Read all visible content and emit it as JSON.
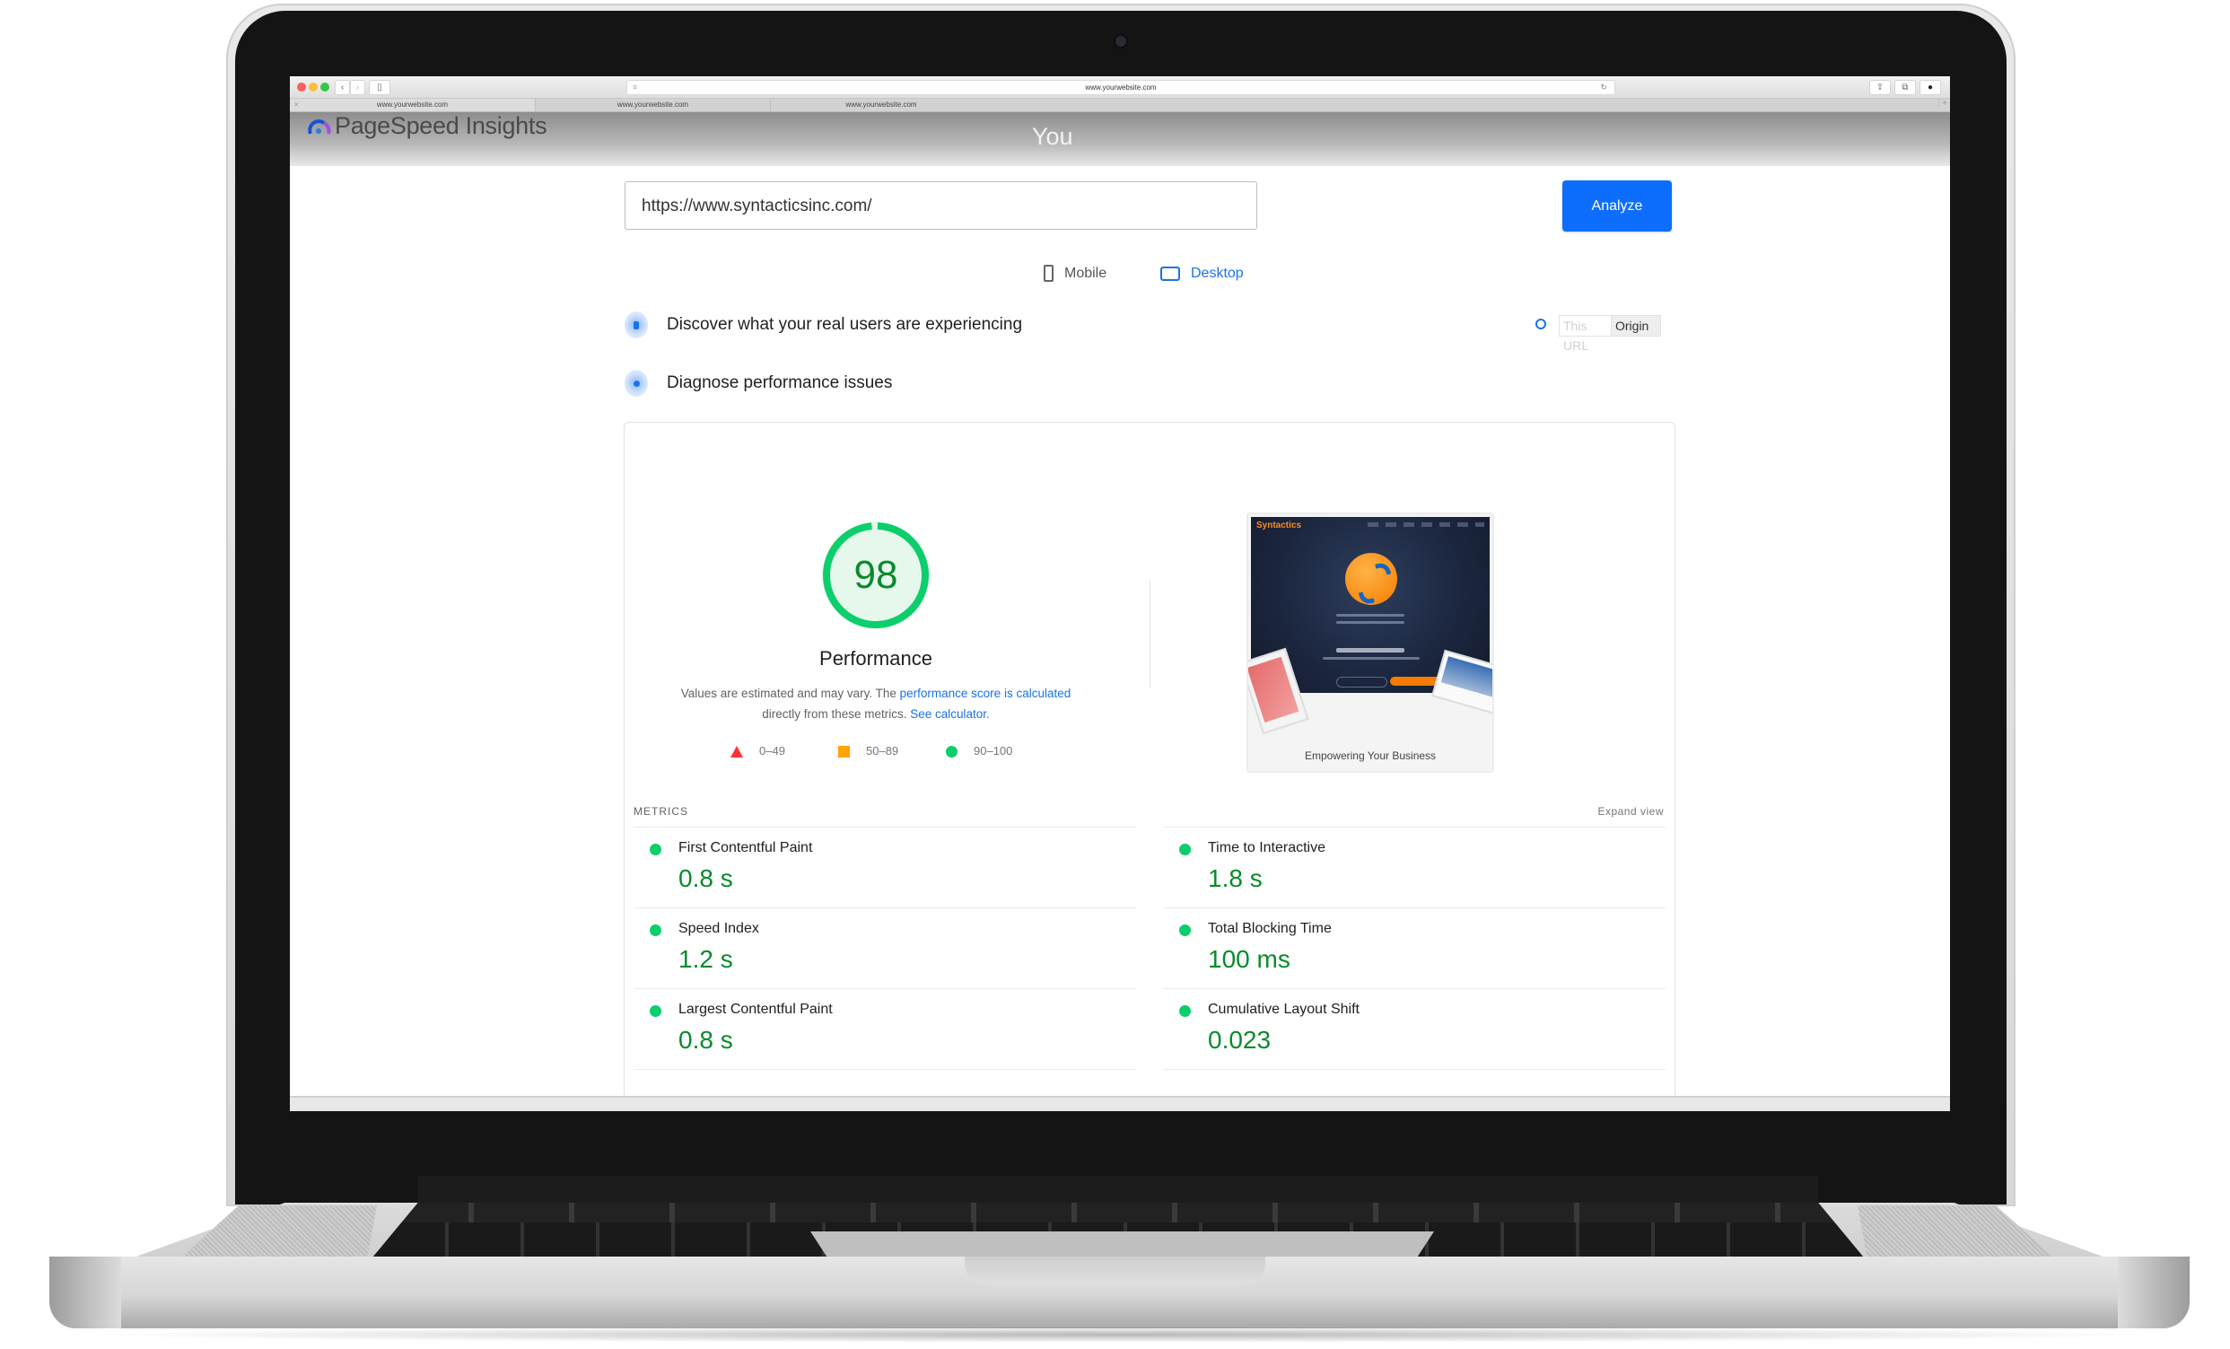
{
  "browser": {
    "address_bar": "www.yourwebsite.com",
    "tabs": [
      {
        "label": "www.yourwebsite.com"
      },
      {
        "label": "www.yourwebsite.com"
      },
      {
        "label": "www.yourwebsite.com"
      }
    ],
    "close_tab_glyph": "×",
    "new_tab_glyph": "+",
    "back_glyph": "‹",
    "forward_glyph": "›"
  },
  "header": {
    "app_title": "PageSpeed Insights",
    "user_label": "You"
  },
  "search": {
    "url_value": "https://www.syntacticsinc.com/",
    "analyze_label": "Analyze"
  },
  "device_tabs": [
    {
      "label": "Mobile",
      "selected": false
    },
    {
      "label": "Desktop",
      "selected": true
    }
  ],
  "sections": {
    "discover": "Discover what your real users are experiencing",
    "diagnose": "Diagnose performance issues",
    "toggle": {
      "this_url": "This URL",
      "origin": "Origin",
      "selected": "Origin"
    }
  },
  "performance": {
    "score": "98",
    "score_value": 98,
    "title": "Performance",
    "note_prefix": "Values are estimated and may vary. The ",
    "note_link1": "performance score is calculated",
    "note_middle": " directly from these metrics. ",
    "note_link2": "See calculator.",
    "legend": [
      {
        "label": "0–49",
        "color": "#ff3333"
      },
      {
        "label": "50–89",
        "color": "#ffa400"
      },
      {
        "label": "90–100",
        "color": "#0cce6b"
      }
    ]
  },
  "screenshot": {
    "brand": "Syntactics",
    "caption": "Empowering Your Business"
  },
  "metrics": {
    "heading": "METRICS",
    "expand_label": "Expand view",
    "left": [
      {
        "name": "First Contentful Paint",
        "value": "0.8 s",
        "status": "pass"
      },
      {
        "name": "Speed Index",
        "value": "1.2 s",
        "status": "pass"
      },
      {
        "name": "Largest Contentful Paint",
        "value": "0.8 s",
        "status": "pass"
      }
    ],
    "right": [
      {
        "name": "Time to Interactive",
        "value": "1.8 s",
        "status": "pass"
      },
      {
        "name": "Total Blocking Time",
        "value": "100 ms",
        "status": "pass"
      },
      {
        "name": "Cumulative Layout Shift",
        "value": "0.023",
        "status": "pass"
      }
    ]
  },
  "colors": {
    "accent": "#1a73e8",
    "pass": "#0cce6b",
    "pass_text": "#0a8a2c",
    "average": "#ffa400",
    "fail": "#ff3333"
  }
}
